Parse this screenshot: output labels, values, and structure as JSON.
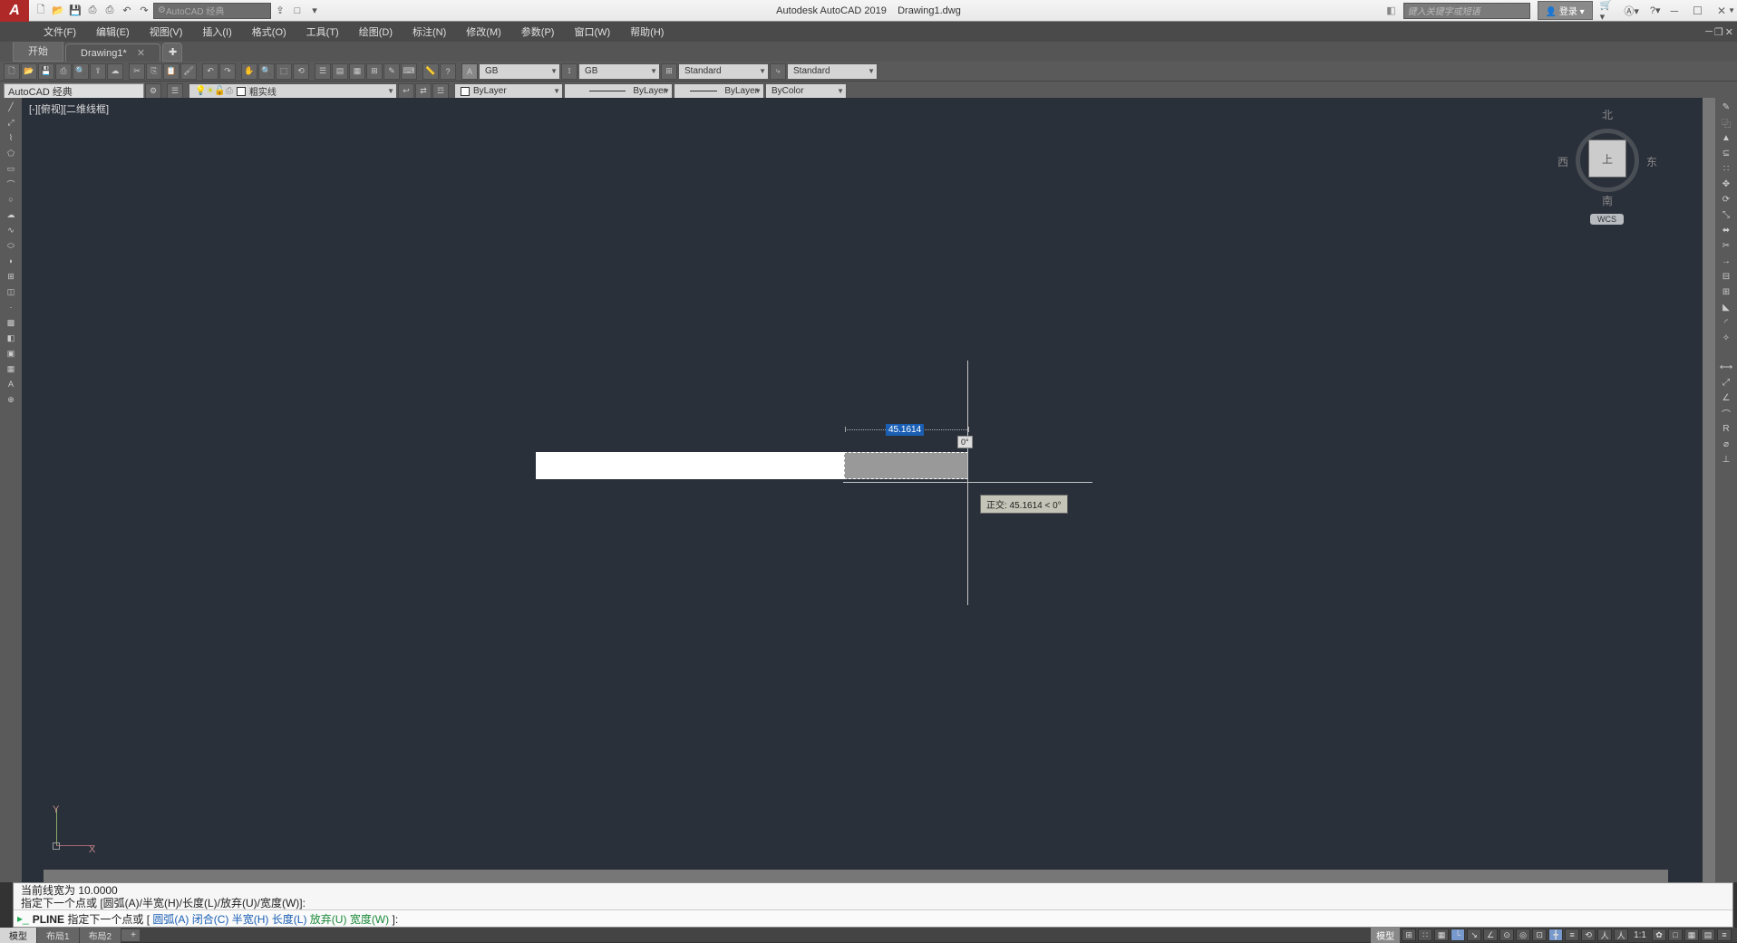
{
  "title": {
    "app": "Autodesk AutoCAD 2019",
    "file": "Drawing1.dwg"
  },
  "qat_workspace": "AutoCAD 经典",
  "search_placeholder": "键入关键字或短语",
  "login": "登录",
  "menubar": [
    "文件(F)",
    "编辑(E)",
    "视图(V)",
    "插入(I)",
    "格式(O)",
    "工具(T)",
    "绘图(D)",
    "标注(N)",
    "修改(M)",
    "参数(P)",
    "窗口(W)",
    "帮助(H)"
  ],
  "tabs": {
    "start": "开始",
    "active": "Drawing1*"
  },
  "toolbar2": {
    "workspace": "AutoCAD 经典",
    "linetype_name": "粗实线",
    "textstyle1": "GB",
    "textstyle2": "GB",
    "dimstyle": "Standard",
    "tablestyle": "Standard",
    "layer_prop": "ByLayer",
    "lineweight": "ByLayer",
    "linetype_sel": "ByLayer",
    "color": "ByColor"
  },
  "canvas": {
    "viewport_label": "[-][俯视][二维线框]",
    "dim_value": "45.1614",
    "angle_value": "0°",
    "tooltip": "正交: 45.1614 < 0°",
    "ucs_x": "X",
    "ucs_y": "Y"
  },
  "viewcube": {
    "n": "北",
    "s": "南",
    "w": "西",
    "e": "东",
    "top": "上",
    "wcs": "WCS"
  },
  "cmd": {
    "hist1": "当前线宽为 10.0000",
    "hist2": "指定下一个点或 [圆弧(A)/半宽(H)/长度(L)/放弃(U)/宽度(W)]:",
    "prompt_prefix": "PLINE",
    "prompt_text": "指定下一个点或 [",
    "options": [
      "圆弧(A)",
      "闭合(C)",
      "半宽(H)",
      "长度(L)",
      "放弃(U)",
      "宽度(W)"
    ],
    "prompt_suffix": "]:"
  },
  "statusbar": {
    "model": "模型",
    "layout1": "布局1",
    "layout2": "布局2",
    "right_label_model": "模型",
    "scale": "1:1",
    "scale_icons": [
      "⊞",
      "∷",
      "▦",
      "└",
      "↘",
      "∠",
      "⊙",
      "◎",
      "⊡",
      "╋",
      "≡",
      "⟲",
      "人",
      "人",
      "1:1",
      "✿",
      "□",
      "▦",
      "▤",
      "≡"
    ]
  }
}
